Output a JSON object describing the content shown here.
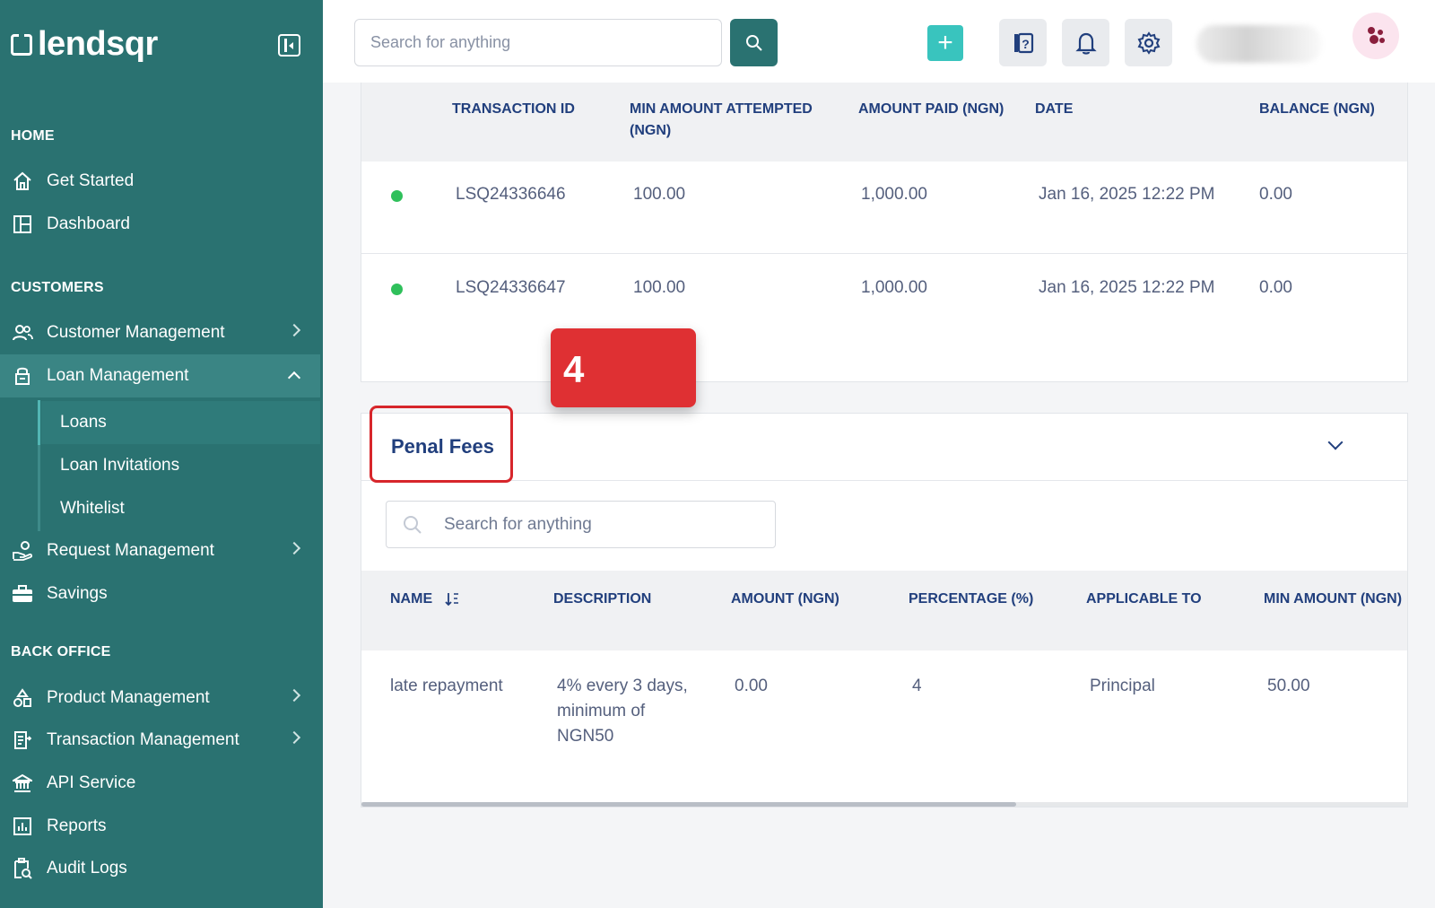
{
  "brand": {
    "name": "lendsqr"
  },
  "topbar": {
    "search_placeholder": "Search for anything",
    "add_label": "+"
  },
  "sidebar": {
    "sections": {
      "home": "HOME",
      "customers": "CUSTOMERS",
      "back_office": "BACK OFFICE"
    },
    "items": {
      "get_started": "Get Started",
      "dashboard": "Dashboard",
      "customer_management": "Customer Management",
      "loan_management": "Loan Management",
      "loans": "Loans",
      "loan_invitations": "Loan Invitations",
      "whitelist": "Whitelist",
      "request_management": "Request Management",
      "savings": "Savings",
      "product_management": "Product Management",
      "transaction_management": "Transaction Management",
      "api_service": "API Service",
      "reports": "Reports",
      "audit_logs": "Audit Logs"
    }
  },
  "transactions": {
    "columns": [
      "TRANSACTION ID",
      "MIN AMOUNT ATTEMPTED (NGN)",
      "AMOUNT PAID (NGN)",
      "DATE",
      "BALANCE (NGN)"
    ],
    "rows": [
      {
        "status_color": "#2fc05b",
        "id": "LSQ24336646",
        "min_amount": "100.00",
        "paid": "1,000.00",
        "date": "Jan 16, 2025 12:22 PM",
        "balance": "0.00"
      },
      {
        "status_color": "#2fc05b",
        "id": "LSQ24336647",
        "min_amount": "100.00",
        "paid": "1,000.00",
        "date": "Jan 16, 2025 12:22 PM",
        "balance": "0.00"
      }
    ]
  },
  "callout": {
    "step": "4"
  },
  "penal_fees": {
    "title": "Penal Fees",
    "search_placeholder": "Search for anything",
    "columns": [
      "NAME",
      "DESCRIPTION",
      "AMOUNT (NGN)",
      "PERCENTAGE (%)",
      "APPLICABLE TO",
      "MIN AMOUNT (NGN)"
    ],
    "rows": [
      {
        "name": "late repayment",
        "description": "4% every 3 days, minimum of NGN50",
        "amount": "0.00",
        "percentage": "4",
        "applicable_to": "Principal",
        "min_amount": "50.00"
      }
    ]
  },
  "colors": {
    "sidebar_bg": "#2a7271",
    "accent": "#39c4be",
    "callout": "#df3033",
    "status_active": "#2fc05b"
  }
}
